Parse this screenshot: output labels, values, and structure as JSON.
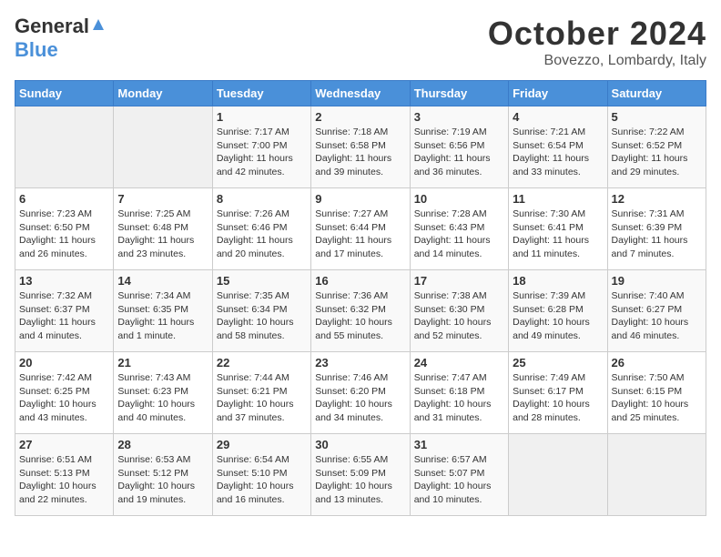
{
  "logo": {
    "text1": "General",
    "text2": "Blue"
  },
  "title": "October 2024",
  "location": "Bovezzo, Lombardy, Italy",
  "days_of_week": [
    "Sunday",
    "Monday",
    "Tuesday",
    "Wednesday",
    "Thursday",
    "Friday",
    "Saturday"
  ],
  "weeks": [
    [
      {
        "day": "",
        "info": ""
      },
      {
        "day": "",
        "info": ""
      },
      {
        "day": "1",
        "info": "Sunrise: 7:17 AM\nSunset: 7:00 PM\nDaylight: 11 hours and 42 minutes."
      },
      {
        "day": "2",
        "info": "Sunrise: 7:18 AM\nSunset: 6:58 PM\nDaylight: 11 hours and 39 minutes."
      },
      {
        "day": "3",
        "info": "Sunrise: 7:19 AM\nSunset: 6:56 PM\nDaylight: 11 hours and 36 minutes."
      },
      {
        "day": "4",
        "info": "Sunrise: 7:21 AM\nSunset: 6:54 PM\nDaylight: 11 hours and 33 minutes."
      },
      {
        "day": "5",
        "info": "Sunrise: 7:22 AM\nSunset: 6:52 PM\nDaylight: 11 hours and 29 minutes."
      }
    ],
    [
      {
        "day": "6",
        "info": "Sunrise: 7:23 AM\nSunset: 6:50 PM\nDaylight: 11 hours and 26 minutes."
      },
      {
        "day": "7",
        "info": "Sunrise: 7:25 AM\nSunset: 6:48 PM\nDaylight: 11 hours and 23 minutes."
      },
      {
        "day": "8",
        "info": "Sunrise: 7:26 AM\nSunset: 6:46 PM\nDaylight: 11 hours and 20 minutes."
      },
      {
        "day": "9",
        "info": "Sunrise: 7:27 AM\nSunset: 6:44 PM\nDaylight: 11 hours and 17 minutes."
      },
      {
        "day": "10",
        "info": "Sunrise: 7:28 AM\nSunset: 6:43 PM\nDaylight: 11 hours and 14 minutes."
      },
      {
        "day": "11",
        "info": "Sunrise: 7:30 AM\nSunset: 6:41 PM\nDaylight: 11 hours and 11 minutes."
      },
      {
        "day": "12",
        "info": "Sunrise: 7:31 AM\nSunset: 6:39 PM\nDaylight: 11 hours and 7 minutes."
      }
    ],
    [
      {
        "day": "13",
        "info": "Sunrise: 7:32 AM\nSunset: 6:37 PM\nDaylight: 11 hours and 4 minutes."
      },
      {
        "day": "14",
        "info": "Sunrise: 7:34 AM\nSunset: 6:35 PM\nDaylight: 11 hours and 1 minute."
      },
      {
        "day": "15",
        "info": "Sunrise: 7:35 AM\nSunset: 6:34 PM\nDaylight: 10 hours and 58 minutes."
      },
      {
        "day": "16",
        "info": "Sunrise: 7:36 AM\nSunset: 6:32 PM\nDaylight: 10 hours and 55 minutes."
      },
      {
        "day": "17",
        "info": "Sunrise: 7:38 AM\nSunset: 6:30 PM\nDaylight: 10 hours and 52 minutes."
      },
      {
        "day": "18",
        "info": "Sunrise: 7:39 AM\nSunset: 6:28 PM\nDaylight: 10 hours and 49 minutes."
      },
      {
        "day": "19",
        "info": "Sunrise: 7:40 AM\nSunset: 6:27 PM\nDaylight: 10 hours and 46 minutes."
      }
    ],
    [
      {
        "day": "20",
        "info": "Sunrise: 7:42 AM\nSunset: 6:25 PM\nDaylight: 10 hours and 43 minutes."
      },
      {
        "day": "21",
        "info": "Sunrise: 7:43 AM\nSunset: 6:23 PM\nDaylight: 10 hours and 40 minutes."
      },
      {
        "day": "22",
        "info": "Sunrise: 7:44 AM\nSunset: 6:21 PM\nDaylight: 10 hours and 37 minutes."
      },
      {
        "day": "23",
        "info": "Sunrise: 7:46 AM\nSunset: 6:20 PM\nDaylight: 10 hours and 34 minutes."
      },
      {
        "day": "24",
        "info": "Sunrise: 7:47 AM\nSunset: 6:18 PM\nDaylight: 10 hours and 31 minutes."
      },
      {
        "day": "25",
        "info": "Sunrise: 7:49 AM\nSunset: 6:17 PM\nDaylight: 10 hours and 28 minutes."
      },
      {
        "day": "26",
        "info": "Sunrise: 7:50 AM\nSunset: 6:15 PM\nDaylight: 10 hours and 25 minutes."
      }
    ],
    [
      {
        "day": "27",
        "info": "Sunrise: 6:51 AM\nSunset: 5:13 PM\nDaylight: 10 hours and 22 minutes."
      },
      {
        "day": "28",
        "info": "Sunrise: 6:53 AM\nSunset: 5:12 PM\nDaylight: 10 hours and 19 minutes."
      },
      {
        "day": "29",
        "info": "Sunrise: 6:54 AM\nSunset: 5:10 PM\nDaylight: 10 hours and 16 minutes."
      },
      {
        "day": "30",
        "info": "Sunrise: 6:55 AM\nSunset: 5:09 PM\nDaylight: 10 hours and 13 minutes."
      },
      {
        "day": "31",
        "info": "Sunrise: 6:57 AM\nSunset: 5:07 PM\nDaylight: 10 hours and 10 minutes."
      },
      {
        "day": "",
        "info": ""
      },
      {
        "day": "",
        "info": ""
      }
    ]
  ]
}
